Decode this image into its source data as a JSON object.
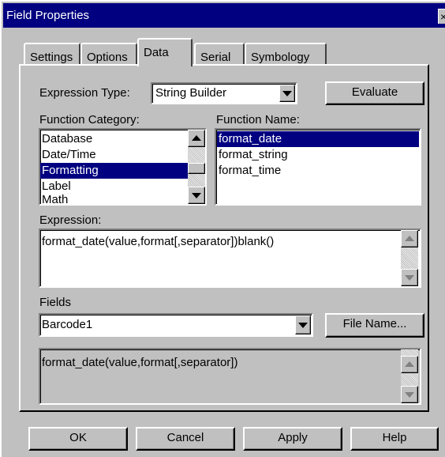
{
  "window": {
    "title": "Field Properties",
    "close_label": "×"
  },
  "tabs": [
    {
      "label": "Settings"
    },
    {
      "label": "Options"
    },
    {
      "label": "Data",
      "active": true
    },
    {
      "label": "Serial"
    },
    {
      "label": "Symbology"
    }
  ],
  "expression_type": {
    "label": "Expression Type:",
    "value": "String Builder"
  },
  "evaluate_label": "Evaluate",
  "function_category": {
    "label": "Function Category:",
    "items": [
      "Database",
      "Date/Time",
      "Formatting",
      "Label",
      "Math"
    ],
    "selected": "Formatting"
  },
  "function_name": {
    "label": "Function Name:",
    "items": [
      "format_date",
      "format_string",
      "format_time"
    ],
    "selected": "format_date"
  },
  "expression": {
    "label": "Expression:",
    "value": "format_date(value,format[,separator])blank()"
  },
  "fields": {
    "label": "Fields",
    "value": "Barcode1"
  },
  "file_name_label": "File Name...",
  "help_text": "format_date(value,format[,separator])",
  "buttons": {
    "ok": "OK",
    "cancel": "Cancel",
    "apply": "Apply",
    "help": "Help"
  },
  "colors": {
    "title_bar": "#000080",
    "face": "#c0c0c0",
    "selection": "#000080"
  }
}
